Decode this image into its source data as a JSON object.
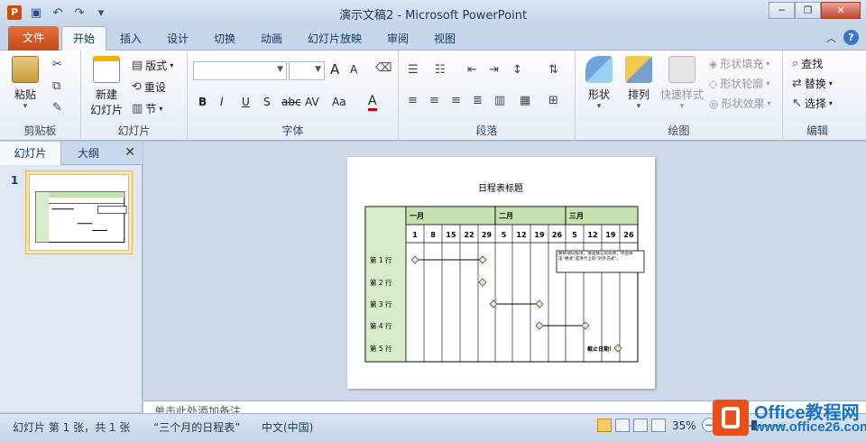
{
  "window": {
    "app_icon": "P",
    "title": "演示文稿2 - Microsoft PowerPoint"
  },
  "quick_access": [
    "save-icon",
    "undo-icon",
    "redo-icon",
    "customize-icon"
  ],
  "window_buttons": [
    "minimize-icon",
    "restore-icon",
    "close-icon"
  ],
  "tabs": {
    "file": "文件",
    "active": "开始",
    "items": [
      "插入",
      "设计",
      "切换",
      "动画",
      "幻灯片放映",
      "审阅",
      "视图"
    ]
  },
  "ribbon": {
    "clipboard": {
      "label": "剪贴板",
      "paste": "粘贴"
    },
    "slides": {
      "label": "幻灯片",
      "new_slide_1": "新建",
      "new_slide_2": "幻灯片",
      "layout": "版式",
      "reset": "重设",
      "section": "节"
    },
    "font": {
      "label": "字体",
      "font_name": "",
      "font_size": "",
      "grow": "A",
      "shrink": "A",
      "bold": "B",
      "italic": "I",
      "underline": "U",
      "shadow": "S",
      "strike": "abc",
      "spacing": "AV",
      "case": "Aa",
      "color": "A"
    },
    "paragraph": {
      "label": "段落"
    },
    "drawing": {
      "label": "绘图",
      "shapes": "形状",
      "arrange": "排列",
      "quick_styles": "快速样式",
      "fill": "形状填充",
      "outline": "形状轮廓",
      "effects": "形状效果"
    },
    "editing": {
      "label": "编辑",
      "find": "查找",
      "replace": "替换",
      "select": "选择"
    }
  },
  "side_panel": {
    "tab_slides": "幻灯片",
    "tab_outline": "大纲",
    "slide_number": "1"
  },
  "slide": {
    "title": "日程表标题",
    "months": [
      "一月",
      "二月",
      "三月"
    ],
    "days": [
      "1",
      "8",
      "15",
      "22",
      "29",
      "5",
      "12",
      "19",
      "26",
      "5",
      "12",
      "19",
      "26"
    ],
    "rows": [
      "第 1 行",
      "第 2 行",
      "第 3 行",
      "第 4 行",
      "第 5 行"
    ],
    "note": "要移动日程项，请选择它的形状，然后单击“格式”选项卡上的“对齐方式”。",
    "deadline_label": "截止日期！",
    "colors": {
      "header_green": "#c4e2b0",
      "label_green": "#d7ecc8",
      "diamond": "#d9efcd",
      "diamond_stroke": "#3a5a2a"
    }
  },
  "notes": {
    "placeholder": "单击此处添加备注"
  },
  "status": {
    "slide_info": "幻灯片 第 1 张，共 1 张",
    "theme": "“三个月的日程表”",
    "language": "中文(中国)",
    "zoom": "35%"
  },
  "watermark": {
    "line1": "Office教程网",
    "line2": "www.office26.com"
  }
}
